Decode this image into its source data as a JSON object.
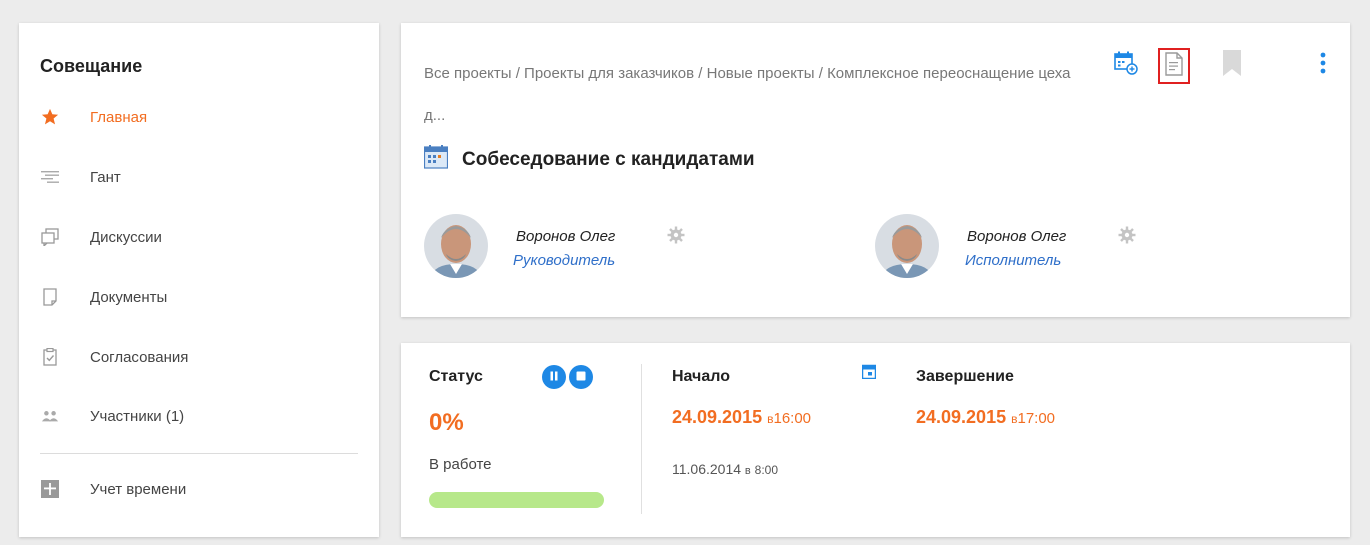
{
  "sidebar": {
    "title": "Совещание",
    "items": [
      {
        "label": "Главная",
        "icon": "star-icon",
        "active": true
      },
      {
        "label": "Гант",
        "icon": "gantt-icon"
      },
      {
        "label": "Дискуссии",
        "icon": "discussions-icon"
      },
      {
        "label": "Документы",
        "icon": "documents-icon"
      },
      {
        "label": "Согласования",
        "icon": "approvals-icon"
      },
      {
        "label": "Участники (1)",
        "icon": "participants-icon"
      },
      {
        "label": "Учет времени",
        "icon": "time-tracking-icon"
      }
    ]
  },
  "header": {
    "breadcrumb": "Все проекты / Проекты для заказчиков / Новые проекты / Комплексное переоснащение цеха д...",
    "title": "Собеседование с кандидатами",
    "people": [
      {
        "name": "Воронов Олег",
        "role": "Руководитель"
      },
      {
        "name": "Воронов Олег",
        "role": "Исполнитель"
      }
    ]
  },
  "status": {
    "status_label": "Статус",
    "percent": "0%",
    "progress": 0,
    "state": "В работе",
    "start_label": "Начало",
    "start_date": "24.09.2015",
    "start_sep": "в",
    "start_time": "16:00",
    "end_label": "Завершение",
    "end_date": "24.09.2015",
    "end_sep": "в",
    "end_time": "17:00",
    "created_date": "11.06.2014",
    "created_sep": "в",
    "created_time": "8:00"
  },
  "colors": {
    "accent": "#f26d21",
    "link": "#2f6fc9",
    "button_blue": "#1e88e5",
    "progress_green": "#b7e88a",
    "highlight_red": "#e02020"
  }
}
